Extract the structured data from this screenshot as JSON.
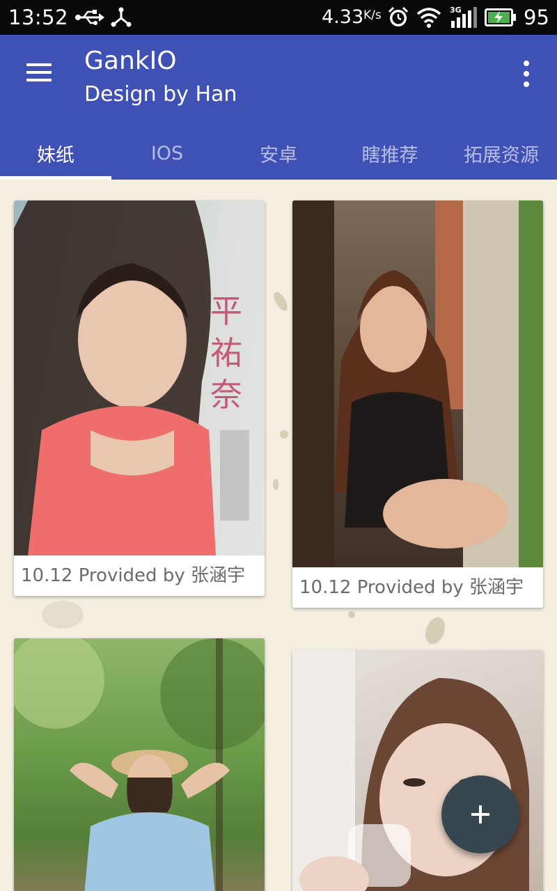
{
  "status_bar": {
    "time": "13:52",
    "speed_value": "4.33",
    "speed_unit": "K/s",
    "network_type": "3G",
    "battery_percent": "95",
    "icons": [
      "usb-icon",
      "tether-icon",
      "alarm-icon",
      "wifi-icon",
      "signal-icon",
      "battery-icon"
    ]
  },
  "app_bar": {
    "title": "GankIO",
    "subtitle": "Design by Han",
    "background_color": "#3f51b5",
    "menu_icon": "hamburger-menu-icon",
    "overflow_icon": "more-vert-icon"
  },
  "tabs": [
    {
      "label": "妹纸",
      "active": true
    },
    {
      "label": "IOS",
      "active": false
    },
    {
      "label": "安卓",
      "active": false
    },
    {
      "label": "瞎推荐",
      "active": false
    },
    {
      "label": "拓展资源",
      "active": false
    }
  ],
  "cards": [
    {
      "caption": "10.12 Provided by 张涵宇",
      "image": "photo of a girl in a pink top leaning against a wall"
    },
    {
      "caption": "10.12 Provided by 张涵宇",
      "image": "photo of a girl in a black tank top sitting in a doorway"
    },
    {
      "caption": "",
      "image": "photo of a girl in a straw hat in a forest"
    },
    {
      "caption": "",
      "image": "photo of a girl drinking from a glass"
    }
  ],
  "fab": {
    "icon": "add-icon",
    "color": "#37474f"
  }
}
